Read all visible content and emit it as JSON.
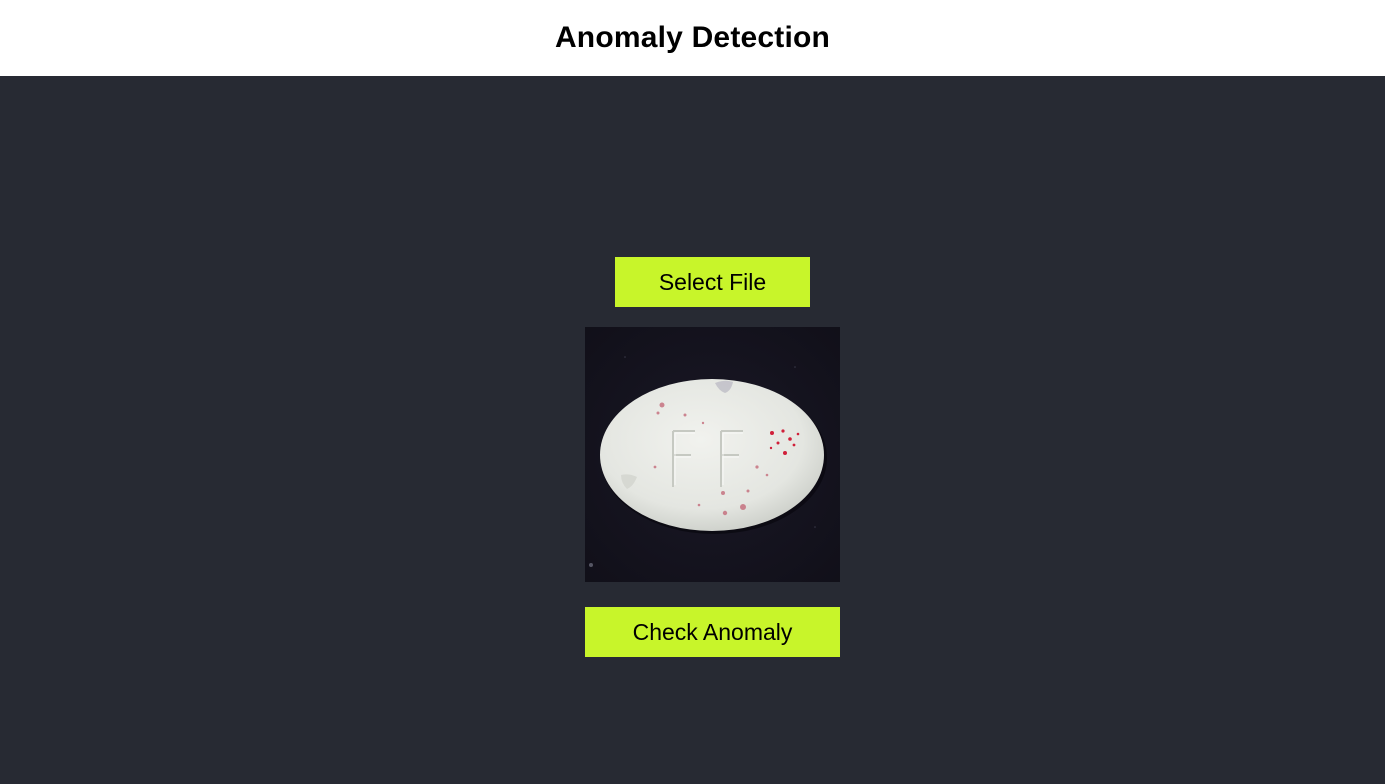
{
  "header": {
    "title": "Anomaly Detection"
  },
  "upload": {
    "select_label": "Select File"
  },
  "preview": {
    "subject": "white oval tablet embossed FF with red speck contamination",
    "imprint": "FF"
  },
  "actions": {
    "check_label": "Check Anomaly"
  },
  "colors": {
    "page_background": "#272a33",
    "header_background": "#ffffff",
    "button_accent": "#c8f52a",
    "image_background": "#14121c",
    "tablet": "#e9ebe6",
    "speck": "#d0203a"
  },
  "icons": {
    "preview": "uploaded-image"
  }
}
